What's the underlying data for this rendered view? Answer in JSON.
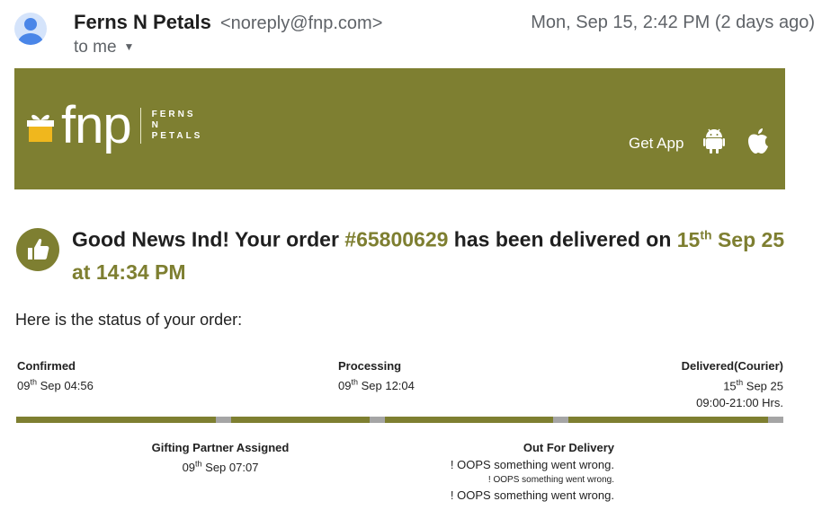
{
  "email": {
    "sender_name": "Ferns N Petals",
    "sender_email": "<noreply@fnp.com>",
    "to": "to me",
    "date": "Mon, Sep 15, 2:42 PM (2 days ago)"
  },
  "banner": {
    "logo_text": "fnp",
    "logo_sub_1": "FERNS",
    "logo_sub_2": "N",
    "logo_sub_3": "PETALS",
    "get_app": "Get App",
    "bg_color": "#7e7f31"
  },
  "headline": {
    "part1": "Good News Ind! Your order ",
    "order_no": "#65800629",
    "part2": " has been delivered on ",
    "day": "15",
    "day_sup": "th",
    "rest": " Sep 25 at 14:34 PM"
  },
  "status_intro": "Here is the status of your order:",
  "steps": {
    "confirmed": {
      "title": "Confirmed",
      "day": "09",
      "sup": "th",
      "rest": " Sep 04:56"
    },
    "processing": {
      "title": "Processing",
      "day": "09",
      "sup": "th",
      "rest": " Sep 12:04"
    },
    "delivered": {
      "title": "Delivered(Courier)",
      "day": "15",
      "sup": "th",
      "rest": " Sep 25",
      "window": "09:00-21:00 Hrs."
    },
    "gifting": {
      "title": "Gifting Partner Assigned",
      "day": "09",
      "sup": "th",
      "rest": " Sep 07:07"
    },
    "out_for_delivery": {
      "title": "Out For Delivery",
      "err1": "! OOPS something went wrong.",
      "err2": "! OOPS something went wrong.",
      "err3": "! OOPS something went wrong."
    }
  },
  "icons": {
    "avatar": "person-icon",
    "thumb": "thumbs-up-icon",
    "android": "android-icon",
    "apple": "apple-icon",
    "gift": "gift-icon"
  }
}
